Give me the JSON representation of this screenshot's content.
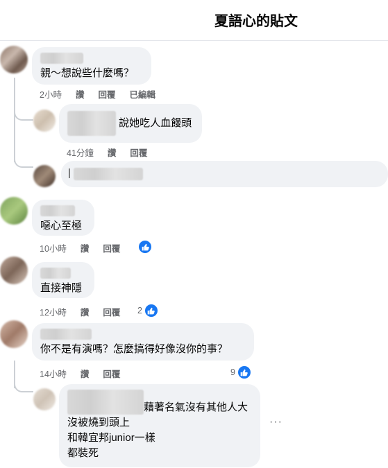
{
  "header": {
    "title": "夏語心的貼文"
  },
  "comments": [
    {
      "text": "親～想說些什麼嗎？",
      "time": "2小時",
      "like_label": "讚",
      "reply_label": "回覆",
      "edited_label": "已編輯",
      "replies": [
        {
          "text": "說她吃人血饅頭",
          "time": "41分鐘",
          "like_label": "讚",
          "reply_label": "回覆"
        }
      ],
      "reply_input_placeholder": "|"
    },
    {
      "text": "噁心至極",
      "time": "10小時",
      "like_label": "讚",
      "reply_label": "回覆",
      "reactions": ""
    },
    {
      "text": "直接神隱",
      "time": "12小時",
      "like_label": "讚",
      "reply_label": "回覆",
      "reactions": "2"
    },
    {
      "text": "你不是有演嗎？怎麼搞得好像沒你的事？",
      "time": "14小時",
      "like_label": "讚",
      "reply_label": "回覆",
      "reactions": "9",
      "replies": [
        {
          "lines": [
            "藉著名氣沒有其他人大",
            "沒被燒到頭上",
            "和韓宜邦junior一樣",
            "都裝死"
          ]
        }
      ]
    }
  ],
  "icons": {
    "like": "thumbs-up-icon",
    "more": "more-options-icon"
  },
  "colors": {
    "like_blue": "#1877f2",
    "bubble": "#f0f2f5",
    "meta_text": "#65676b"
  }
}
